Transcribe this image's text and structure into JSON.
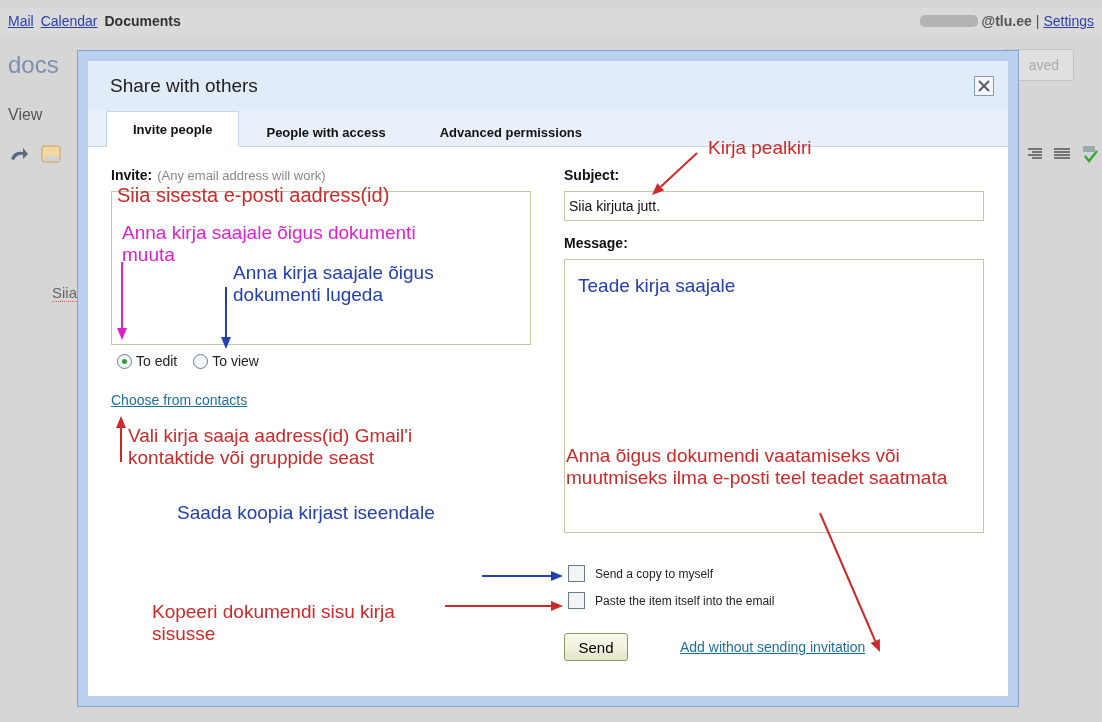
{
  "top_bar": {
    "links": [
      {
        "label": "Mail",
        "kind": "link"
      },
      {
        "label": "Calendar",
        "kind": "link"
      },
      {
        "label": "Documents",
        "kind": "current"
      }
    ],
    "account": "@tlu.ee",
    "separator": "|",
    "settings": "Settings"
  },
  "background": {
    "logo": "docs",
    "menu": "View",
    "saved_button": "aved",
    "document_text": "Siia"
  },
  "dialog": {
    "title": "Share with others",
    "tabs": [
      {
        "label": "Invite people",
        "selected": true
      },
      {
        "label": "People with access",
        "selected": false
      },
      {
        "label": "Advanced permissions",
        "selected": false
      }
    ],
    "invite": {
      "label": "Invite:",
      "hint": "(Any email address will work)"
    },
    "permissions": [
      {
        "label": "To edit",
        "selected": true
      },
      {
        "label": "To view",
        "selected": false
      }
    ],
    "contacts_link": "Choose from contacts",
    "subject": {
      "label": "Subject:",
      "value": "Siia kirjuta jutt."
    },
    "message": {
      "label": "Message:"
    },
    "options": [
      {
        "label": "Send a copy to myself",
        "checked": false
      },
      {
        "label": "Paste the item itself into the email",
        "checked": false
      }
    ],
    "send_button": "Send",
    "add_link": "Add without sending invitation"
  },
  "annotations": [
    {
      "text": "Siia sisesta e-posti aadress(id)",
      "color": "#cc2a2a"
    },
    {
      "text": "Anna kirja saajale õigus dokumenti muuta",
      "color": "#e020d0"
    },
    {
      "text": "Anna kirja saajale õigus dokumenti lugeda",
      "color": "#2440b0"
    },
    {
      "text": "Kirja pealkiri",
      "color": "#cc2a2a"
    },
    {
      "text": "Teade kirja saajale",
      "color": "#2440b0"
    },
    {
      "text": "Vali kirja saaja aadress(id) Gmail'i kontaktide või gruppide seast",
      "color": "#cc2a2a"
    },
    {
      "text": "Anna õigus dokumendi vaatamiseks või muutmiseks ilma e-posti teel teadet saatmata",
      "color": "#cc2a2a"
    },
    {
      "text": "Saada koopia kirjast iseendale",
      "color": "#2440b0"
    },
    {
      "text": "Kopeeri dokumendi sisu kirja sisusse",
      "color": "#cc2a2a"
    }
  ]
}
